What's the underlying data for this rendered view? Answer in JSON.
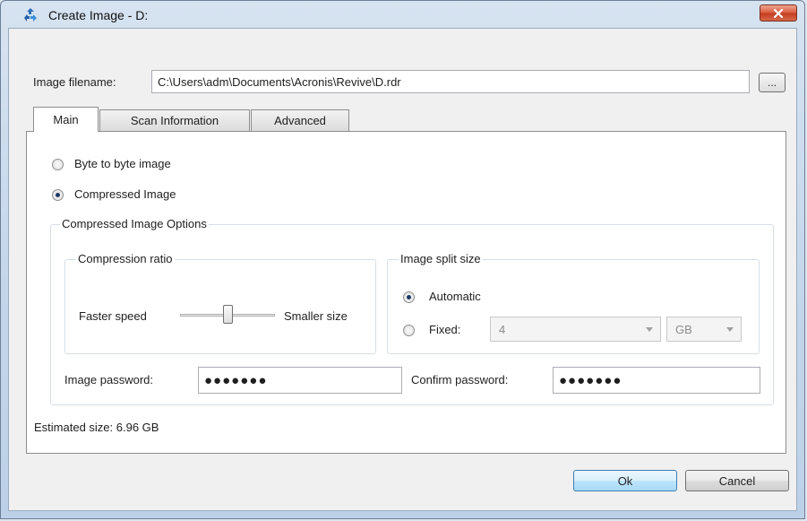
{
  "window": {
    "title": "Create Image - D:",
    "icon": "acronis-recycle-icon",
    "close_icon": "close-icon"
  },
  "filename": {
    "label": "Image filename:",
    "value": "C:\\Users\\adm\\Documents\\Acronis\\Revive\\D.rdr",
    "browse_label": "..."
  },
  "tabs": [
    {
      "label": "Main",
      "active": true
    },
    {
      "label": "Scan Information",
      "active": false
    },
    {
      "label": "Advanced",
      "active": false
    }
  ],
  "main": {
    "byte_to_byte_label": "Byte to byte image",
    "compressed_label": "Compressed Image",
    "selected_mode": "compressed",
    "options_group_label": "Compressed Image Options",
    "compression": {
      "group_label": "Compression ratio",
      "left_label": "Faster speed",
      "right_label": "Smaller size",
      "slider_fraction": 0.5
    },
    "split": {
      "group_label": "Image split size",
      "automatic_label": "Automatic",
      "fixed_label": "Fixed:",
      "selected": "automatic",
      "fixed_value": "4",
      "unit_value": "GB"
    },
    "password_label": "Image password:",
    "password_value": "●●●●●●●",
    "confirm_label": "Confirm password:",
    "confirm_value": "●●●●●●●",
    "estimated_size": "Estimated size: 6.96 GB"
  },
  "buttons": {
    "ok": "Ok",
    "cancel": "Cancel"
  },
  "colors": {
    "window_frame": "#c3d5ea",
    "close_button": "#c9472a",
    "default_button": "#bee6fd"
  }
}
